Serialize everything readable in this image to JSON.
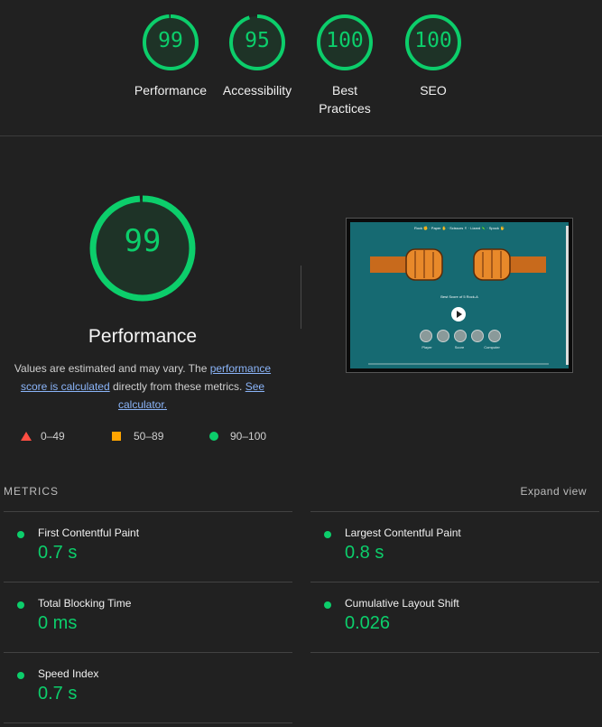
{
  "categories": [
    {
      "score": "99",
      "label": "Performance",
      "fraction": 0.99
    },
    {
      "score": "95",
      "label": "Accessibility",
      "fraction": 0.95
    },
    {
      "score": "100",
      "label": "Best Practices",
      "fraction": 1.0
    },
    {
      "score": "100",
      "label": "SEO",
      "fraction": 1.0
    }
  ],
  "performance": {
    "score": "99",
    "fraction": 0.99,
    "title": "Performance",
    "desc_pre": "Values are estimated and may vary. The ",
    "desc_link1": "performance score is calculated",
    "desc_mid": " directly from these metrics. ",
    "desc_link2": "See calculator."
  },
  "legend": {
    "fail": "0–49",
    "average": "50–89",
    "pass": "90–100"
  },
  "colors": {
    "pass": "#0cce6b",
    "average": "#ffa400",
    "fail": "#ff4e42",
    "background": "#212121",
    "link": "#8ab4f8"
  },
  "screenshot": {
    "nav_text": "Rock ✊ · Paper ✋ · Scissors ✌ · Lizard 🦎 · Spock 🖖",
    "heading": "Best Score of 5 Rock-A",
    "player": "Player",
    "score": "Score",
    "computer": "Computer"
  },
  "metrics": {
    "header": "METRICS",
    "expand_label": "Expand view",
    "items": [
      {
        "name": "First Contentful Paint",
        "value": "0.7 s"
      },
      {
        "name": "Largest Contentful Paint",
        "value": "0.8 s"
      },
      {
        "name": "Total Blocking Time",
        "value": "0 ms"
      },
      {
        "name": "Cumulative Layout Shift",
        "value": "0.026"
      },
      {
        "name": "Speed Index",
        "value": "0.7 s"
      }
    ]
  }
}
